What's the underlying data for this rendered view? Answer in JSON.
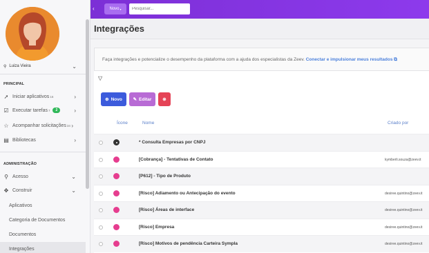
{
  "topbar": {
    "back": "‹",
    "new_label": "Novo",
    "new_caret": "▾",
    "search_placeholder": "Pesquisar..."
  },
  "sidebar": {
    "user": {
      "name": "Luiza Vieira"
    },
    "principal": {
      "title": "PRINCIPAL",
      "items": [
        {
          "label": "Iniciar aplicativos",
          "sup": "16"
        },
        {
          "label": "Executar tarefas",
          "sup": "7",
          "badge": "2"
        },
        {
          "label": "Acompanhar solicitações",
          "sup": "34"
        },
        {
          "label": "Bibliotecas"
        }
      ]
    },
    "admin": {
      "title": "ADMINISTRAÇÃO",
      "items": [
        {
          "label": "Acesso"
        },
        {
          "label": "Construir"
        }
      ],
      "sub": [
        "Aplicativos",
        "Categoria de Documentos",
        "Documentos",
        "Integrações"
      ]
    }
  },
  "page": {
    "title": "Integrações",
    "info_text": "Faça integrações e potencialize o desempenho da plataforma com a ajuda dos especialistas da Zeev.",
    "info_link": "Conectar e impulsionar meus resultados",
    "buttons": {
      "new": "Novo",
      "edit": "Editar"
    },
    "columns": {
      "icon": "Ícone",
      "name": "Nome",
      "created_by": "Criado por"
    },
    "rows": [
      {
        "name": "* Consulta Empresas por CNPJ",
        "by": ""
      },
      {
        "name": "[Cobrança] - Tentativas de Contato",
        "by": "kymberli.souza@zeev.it"
      },
      {
        "name": "[P612] - Tipo de Produto",
        "by": ""
      },
      {
        "name": "[Risco] Adiamento ou Antecipação do evento",
        "by": "desiree.quintino@zeev.it"
      },
      {
        "name": "[Risco] Áreas de interface",
        "by": "desiree.quintino@zeev.it"
      },
      {
        "name": "[Risco] Empresa",
        "by": "desiree.quintino@zeev.it"
      },
      {
        "name": "[Risco] Motivos de pendência Carteira Sympla",
        "by": "desiree.quintino@zeev.it"
      }
    ]
  }
}
